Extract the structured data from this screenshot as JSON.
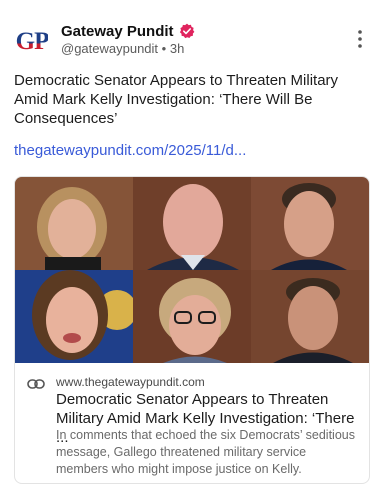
{
  "post": {
    "avatar_text": "GP",
    "account_name": "Gateway Pundit",
    "handle": "@gatewaypundit",
    "separator": "•",
    "time": "3h",
    "text": "Democratic Senator Appears to Threaten Military Amid Mark Kelly Investigation: ‘There Will Be Consequences’",
    "link_text": "thegatewaypundit.com/2025/11/d..."
  },
  "card": {
    "domain": "www.thegatewaypundit.com",
    "title": "Democratic Senator Appears to Threaten Military Amid Mark Kelly Investigation: ‘There ...",
    "description": "In comments that echoed the six Democrats’ seditious message, Gallego threatened military service members who might impose justice on Kelly."
  },
  "icons": {
    "verified": "verified-badge-icon",
    "more": "more-vertical-icon",
    "link": "link-icon"
  },
  "colors": {
    "link": "#3a5bd8",
    "verified": "#e0245e",
    "brand_blue": "#1f3f86",
    "brand_red": "#c81e2f"
  }
}
